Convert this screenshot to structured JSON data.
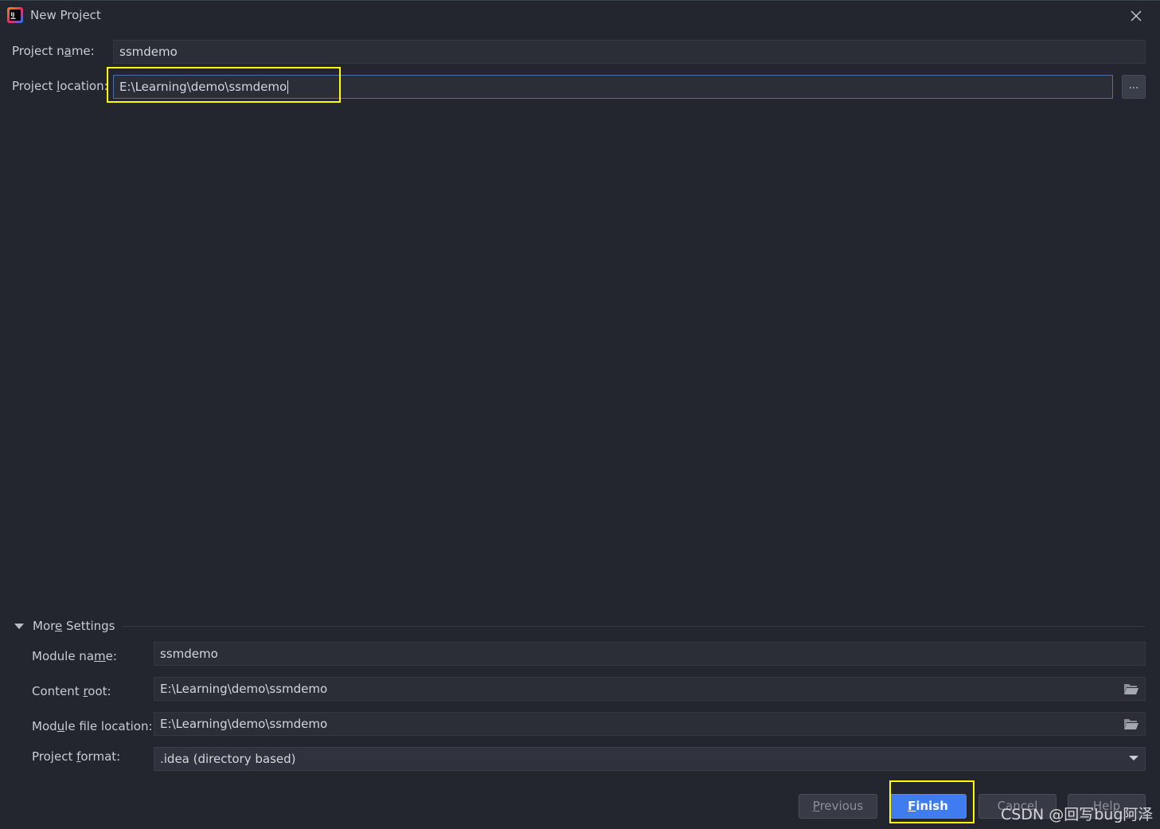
{
  "window": {
    "title": "New Project",
    "close_icon": "close-icon",
    "app_icon": "intellij-idea-icon"
  },
  "form": {
    "project_name": {
      "label_pre": "Project n",
      "label_u": "a",
      "label_post": "me:",
      "value": "ssmdemo"
    },
    "project_location": {
      "label_pre": "Project ",
      "label_u": "l",
      "label_post": "ocation:",
      "value": "E:\\Learning\\demo\\ssmdemo",
      "browse_label": "..."
    }
  },
  "more_settings": {
    "header_pre": "Mor",
    "header_u": "e",
    "header_post": " Settings",
    "module_name": {
      "label_pre": "Module na",
      "label_u": "m",
      "label_post": "e:",
      "value": "ssmdemo"
    },
    "content_root": {
      "label_pre": "Content ",
      "label_u": "r",
      "label_post": "oot:",
      "value": "E:\\Learning\\demo\\ssmdemo",
      "icon": "folder-open-icon"
    },
    "module_file_location": {
      "label_pre": "Mod",
      "label_u": "u",
      "label_post": "le file location:",
      "value": "E:\\Learning\\demo\\ssmdemo",
      "icon": "folder-open-icon"
    },
    "project_format": {
      "label_pre": "Project ",
      "label_u": "f",
      "label_post": "ormat:",
      "value": ".idea (directory based)",
      "icon": "chevron-down-icon"
    }
  },
  "buttons": {
    "previous": {
      "u": "P",
      "rest": "revious"
    },
    "finish": {
      "u": "F",
      "rest": "inish"
    },
    "cancel": "Cancel",
    "help": "Help"
  },
  "watermark": "CSDN @回写bug阿泽",
  "colors": {
    "background": "#23262f",
    "field": "#2b2e37",
    "focus_border": "#4b6ea8",
    "primary_button": "#3f7cf0",
    "highlight": "#ffff00"
  }
}
